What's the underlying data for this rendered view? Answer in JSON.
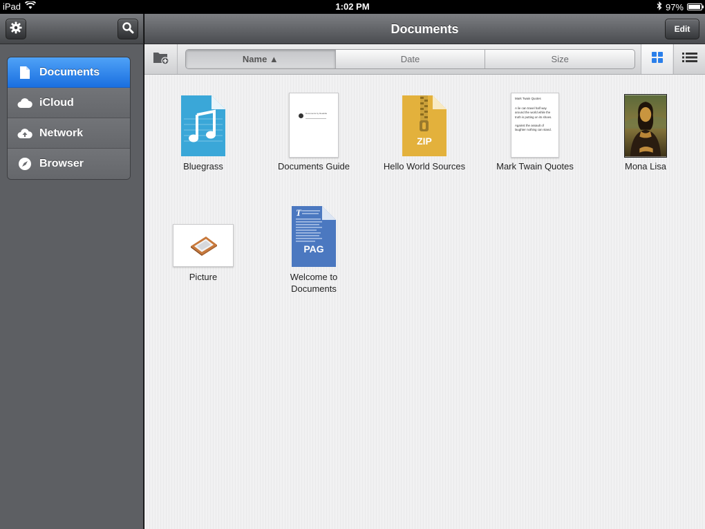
{
  "status_bar": {
    "device": "iPad",
    "time": "1:02 PM",
    "battery": "97%",
    "battery_level": 0.97
  },
  "sidebar": {
    "settings_icon": "gear-icon",
    "search_icon": "search-icon",
    "items": [
      {
        "label": "Documents",
        "icon": "document-icon",
        "active": true
      },
      {
        "label": "iCloud",
        "icon": "cloud-icon",
        "active": false
      },
      {
        "label": "Network",
        "icon": "network-cloud-icon",
        "active": false
      },
      {
        "label": "Browser",
        "icon": "compass-icon",
        "active": false
      }
    ]
  },
  "navbar": {
    "title": "Documents",
    "edit_label": "Edit"
  },
  "toolbar": {
    "sort": {
      "name": "Name ▲",
      "date": "Date",
      "size": "Size",
      "selected": "name"
    },
    "view_mode": "grid"
  },
  "files": [
    {
      "name": "Bluegrass",
      "type": "audio"
    },
    {
      "name": "Documents Guide",
      "type": "pdf",
      "thumb_text": "Documents by Readdle"
    },
    {
      "name": "Hello World Sources",
      "type": "zip",
      "badge": "ZIP"
    },
    {
      "name": "Mark Twain Quotes",
      "type": "text",
      "thumb_title": "Mark Twain Quotes",
      "thumb_lines": [
        "A lie can travel half way around the world while the truth is putting on its shoes.",
        "Against the assault of laughter nothing can stand."
      ]
    },
    {
      "name": "Mona Lisa",
      "type": "image"
    },
    {
      "name": "Picture",
      "type": "picture"
    },
    {
      "name": "Welcome to Documents",
      "name_line1": "Welcome to",
      "name_line2": "Documents",
      "type": "pages",
      "badge": "PAG"
    }
  ],
  "colors": {
    "accent_blue": "#2a7fea",
    "audio_blue": "#3aa7d8",
    "zip_gold": "#e3b13c",
    "pages_blue": "#4b78c0"
  }
}
